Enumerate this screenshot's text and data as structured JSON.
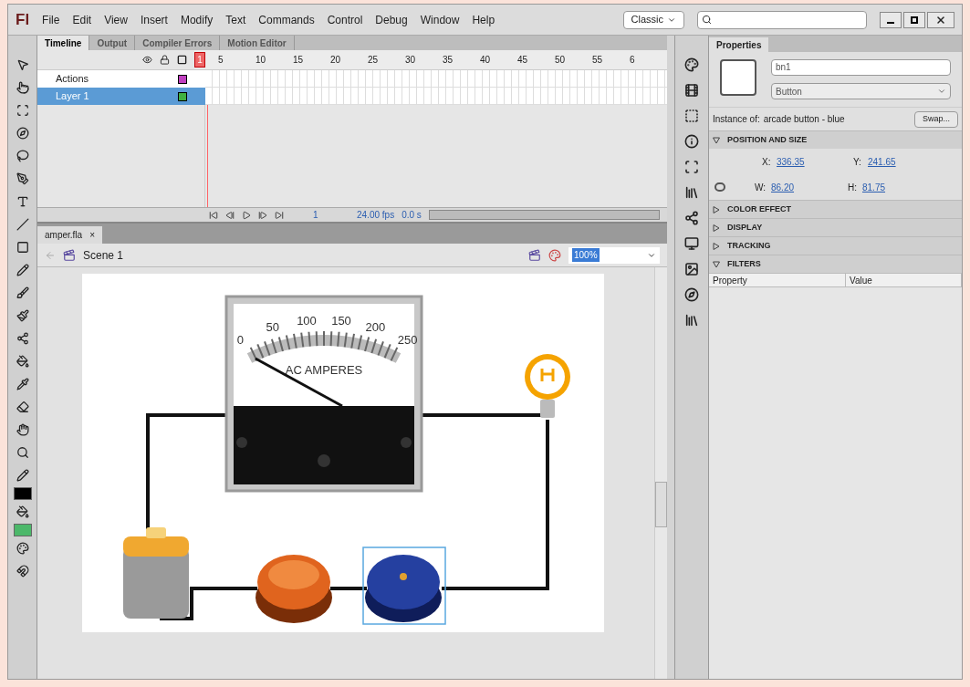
{
  "app": {
    "logo": "Fl"
  },
  "menu": [
    "File",
    "Edit",
    "View",
    "Insert",
    "Modify",
    "Text",
    "Commands",
    "Control",
    "Debug",
    "Window",
    "Help"
  ],
  "workspace": {
    "value": "Classic"
  },
  "panel_tabs": [
    {
      "label": "Timeline",
      "selected": true
    },
    {
      "label": "Output",
      "selected": false
    },
    {
      "label": "Compiler Errors",
      "selected": false
    },
    {
      "label": "Motion Editor",
      "selected": false
    }
  ],
  "timeline": {
    "frame_numbers": [
      "1",
      "5",
      "10",
      "15",
      "20",
      "25",
      "30",
      "35",
      "40",
      "45",
      "50",
      "55",
      "6"
    ],
    "layers": [
      {
        "name": "Actions",
        "selected": false,
        "color": "#c040c0"
      },
      {
        "name": "Layer 1",
        "selected": true,
        "color": "#40b040"
      }
    ],
    "current_frame": "1",
    "fps": "24.00 fps",
    "time": "0.0 s"
  },
  "document": {
    "tab": "amper.fla",
    "close": "×",
    "scene": "Scene 1",
    "zoom": "100%"
  },
  "meter": {
    "scale": [
      "0",
      "50",
      "100",
      "150",
      "200",
      "250"
    ],
    "caption": "AC AMPERES"
  },
  "swatches": [
    {
      "color": "#000000"
    },
    {
      "color": "#4cb86a"
    }
  ],
  "properties": {
    "tab": "Properties",
    "instance_name": "bn1",
    "type": "Button",
    "instance_label": "Instance of:",
    "instance_value": "arcade button - blue",
    "swap": "Swap...",
    "sections": [
      {
        "title": "POSITION AND SIZE",
        "expanded": true,
        "kind": "position"
      },
      {
        "title": "COLOR EFFECT",
        "expanded": false
      },
      {
        "title": "DISPLAY",
        "expanded": false
      },
      {
        "title": "TRACKING",
        "expanded": false
      },
      {
        "title": "FILTERS",
        "expanded": true,
        "kind": "filters"
      }
    ],
    "x": {
      "label": "X:",
      "value": "336.35"
    },
    "y": {
      "label": "Y:",
      "value": "241.65"
    },
    "w": {
      "label": "W:",
      "value": "86.20"
    },
    "h": {
      "label": "H:",
      "value": "81.75"
    },
    "filter_columns": [
      "Property",
      "Value"
    ]
  }
}
